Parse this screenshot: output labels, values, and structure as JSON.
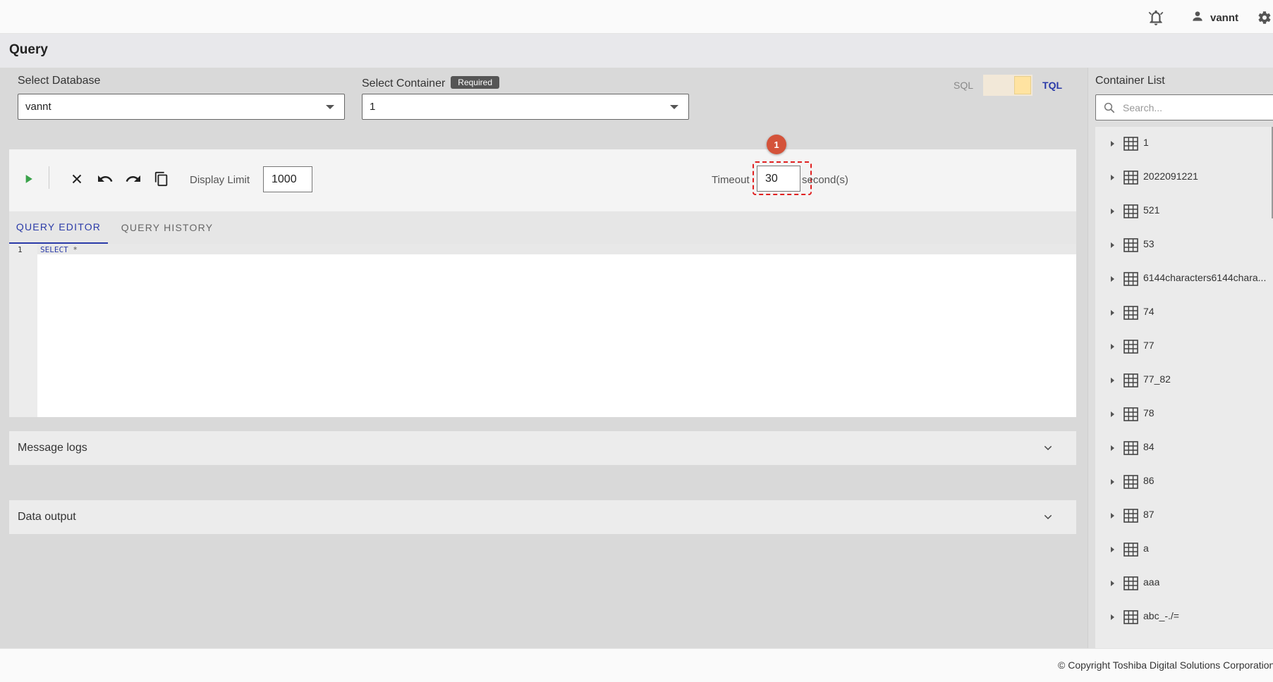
{
  "header": {
    "username": "vannt",
    "icons": [
      "bell-icon",
      "user-icon",
      "gear-icon"
    ]
  },
  "page": {
    "title": "Query"
  },
  "query_form": {
    "database_label": "Select Database",
    "database_value": "vannt",
    "container_label": "Select Container",
    "container_required_badge": "Required",
    "container_value": "1",
    "lang_sql": "SQL",
    "lang_tql": "TQL",
    "selected_lang": "TQL"
  },
  "toolbar": {
    "display_limit_label": "Display Limit",
    "display_limit_value": "1000",
    "timeout_label": "Timeout",
    "timeout_value": "30",
    "timeout_unit": "second(s)",
    "step_badge": "1",
    "icons": [
      "play-icon",
      "clear-icon",
      "undo-icon",
      "redo-icon",
      "copy-icon"
    ]
  },
  "tabs": [
    {
      "label": "QUERY EDITOR",
      "active": true
    },
    {
      "label": "QUERY HISTORY",
      "active": false
    }
  ],
  "editor": {
    "line_number": "1",
    "keyword": "SELECT",
    "rest": " *"
  },
  "panels": {
    "message_logs": "Message logs",
    "data_output": "Data output"
  },
  "container_list": {
    "title": "Container List",
    "search_placeholder": "Search...",
    "items": [
      "1",
      "2022091221",
      "521",
      "53",
      "6144characters6144chara...",
      "74",
      "77",
      "77_82",
      "78",
      "84",
      "86",
      "87",
      "a",
      "aaa",
      "abc_-./="
    ]
  },
  "footer": {
    "copyright": "© Copyright Toshiba Digital Solutions Corporation"
  },
  "colors": {
    "accent": "#2a3aa8",
    "play": "#3aa24a",
    "badge": "#d4533a",
    "highlight_border": "#e02020"
  }
}
